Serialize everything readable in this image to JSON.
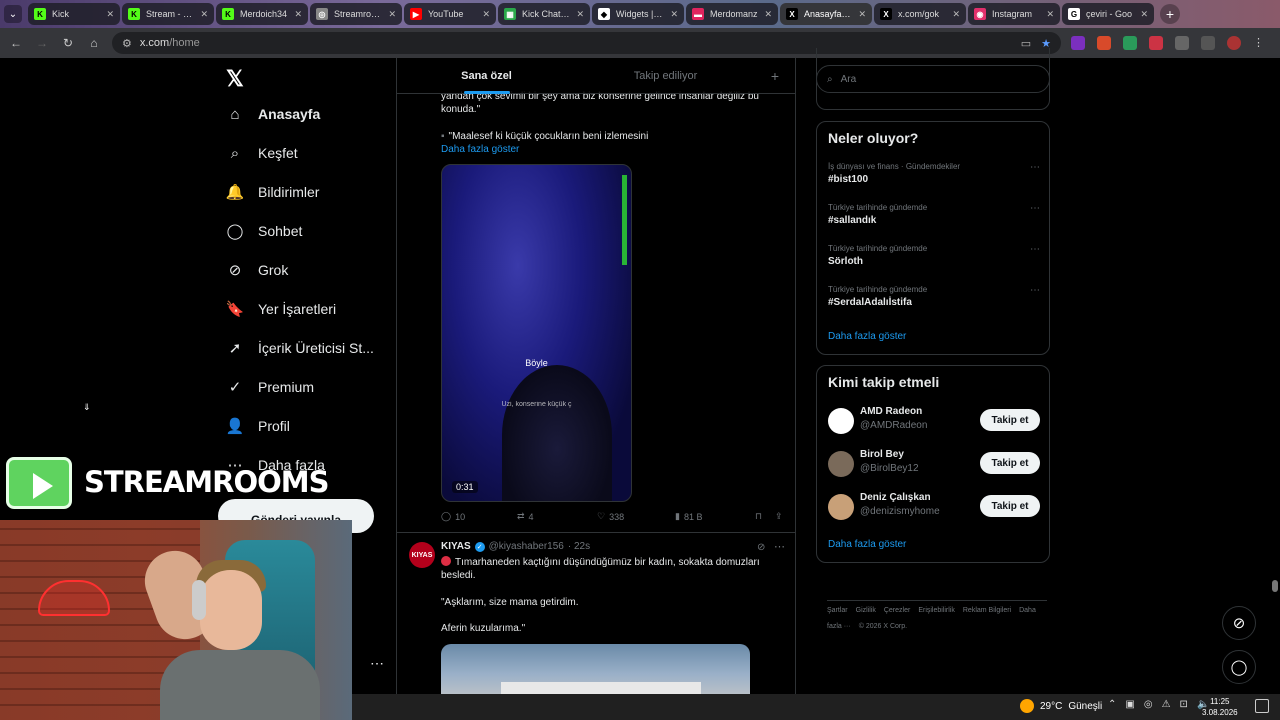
{
  "browser": {
    "tabs": [
      {
        "title": "Kick",
        "fav_color": "#53fc18",
        "fav_glyph": "K"
      },
      {
        "title": "Stream - Kick",
        "fav_color": "#53fc18",
        "fav_glyph": "K"
      },
      {
        "title": "Merdoich34",
        "fav_color": "#53fc18",
        "fav_glyph": "K"
      },
      {
        "title": "Streamrooms",
        "fav_color": "#888888",
        "fav_glyph": "◎"
      },
      {
        "title": "YouTube",
        "fav_color": "#ff0000",
        "fav_glyph": "▶"
      },
      {
        "title": "Kick Chat Se",
        "fav_color": "#2aa84a",
        "fav_glyph": "▦"
      },
      {
        "title": "Widgets | Va",
        "fav_color": "#ffffff",
        "fav_glyph": "◆"
      },
      {
        "title": "Merdomanz",
        "fav_color": "#e0245e",
        "fav_glyph": "▬"
      },
      {
        "title": "Anasayfa / X",
        "fav_color": "#000000",
        "fav_glyph": "X",
        "active": true
      },
      {
        "title": "x.com/gok",
        "fav_color": "#000000",
        "fav_glyph": "X"
      },
      {
        "title": "Instagram",
        "fav_color": "#e1306c",
        "fav_glyph": "◉"
      },
      {
        "title": "çeviri - Goo",
        "fav_color": "#ffffff",
        "fav_glyph": "G"
      }
    ],
    "url_host": "x.com",
    "url_path": "/home"
  },
  "nav": {
    "items": [
      {
        "label": "Anasayfa",
        "icon": "home-icon",
        "glyph": "⌂",
        "bold": true
      },
      {
        "label": "Keşfet",
        "icon": "search-icon",
        "glyph": "⌕"
      },
      {
        "label": "Bildirimler",
        "icon": "bell-icon",
        "glyph": "🔔"
      },
      {
        "label": "Sohbet",
        "icon": "chat-icon",
        "glyph": "◯"
      },
      {
        "label": "Grok",
        "icon": "grok-icon",
        "glyph": "⊘"
      },
      {
        "label": "Yer İşaretleri",
        "icon": "bookmark-icon",
        "glyph": "🔖"
      },
      {
        "label": "İçerik Üreticisi St...",
        "icon": "rocket-icon",
        "glyph": "➚"
      },
      {
        "label": "Premium",
        "icon": "verified-icon",
        "glyph": "✓"
      },
      {
        "label": "Profil",
        "icon": "person-icon",
        "glyph": "👤"
      },
      {
        "label": "Daha fazla",
        "icon": "more-circle-icon",
        "glyph": "⋯"
      }
    ],
    "post_button": "Gönderi yayınla"
  },
  "feed": {
    "tabs": [
      "Sana özel",
      "Takip ediliyor"
    ],
    "post1": {
      "text_line1": "yandan çok sevimli bir şey ama biz konserine gelince insanlar değiliz bu",
      "text_line2": "konuda.\"",
      "quote": "\"Maalesef ki küçük çocukların beni izlemesini",
      "show_more": "Daha fazla göster",
      "video_caption": "Böyle",
      "video_subcaption": "Uzi, konserine küçük ç",
      "video_duration": "0:31",
      "replies": "10",
      "reposts": "4",
      "likes": "338",
      "views": "81 B"
    },
    "post2": {
      "avatar_text": "KIYAS",
      "name": "KIYAS",
      "handle": "@kiyashaber156",
      "time": "· 22s",
      "text1": "Tımarhaneden kaçtığını düşündüğümüz bir kadın, sokakta domuzları",
      "text2": "besledi.",
      "text3": "\"Aşklarım, size mama getirdim.",
      "text4": "Aferin kuzularıma.\""
    }
  },
  "sidebar": {
    "search_placeholder": "Ara",
    "trends_title": "Neler oluyor?",
    "trends": [
      {
        "category": "İş dünyası ve finans · Gündemdekiler",
        "tag": "#bist100"
      },
      {
        "category": "Türkiye tarihinde gündemde",
        "tag": "#sallandık"
      },
      {
        "category": "Türkiye tarihinde gündemde",
        "tag": "Sörloth"
      },
      {
        "category": "Türkiye tarihinde gündemde",
        "tag": "#SerdalAdalıİstifa"
      }
    ],
    "trends_more": "Daha fazla göster",
    "who_title": "Kimi takip etmeli",
    "who": [
      {
        "name": "AMD Radeon",
        "handle": "@AMDRadeon",
        "avatar_color": "#ffffff"
      },
      {
        "name": "Birol Bey",
        "handle": "@BirolBey12",
        "avatar_color": "#7a6a5a"
      },
      {
        "name": "Deniz Çalışkan",
        "handle": "@denizismyhome",
        "avatar_color": "#c8a078"
      }
    ],
    "follow_label": "Takip et",
    "who_more": "Daha fazla göster",
    "footer": [
      "Şartlar",
      "Gizlilik",
      "Çerezler",
      "Erişilebilirlik",
      "Reklam Bilgileri",
      "Daha fazla ···",
      "© 2026 X Corp."
    ]
  },
  "overlay": {
    "brand": "STREAMROOMS"
  },
  "taskbar": {
    "temp": "29°C",
    "weather": "Güneşli",
    "time": "11:25",
    "date": "3.08.2026"
  }
}
